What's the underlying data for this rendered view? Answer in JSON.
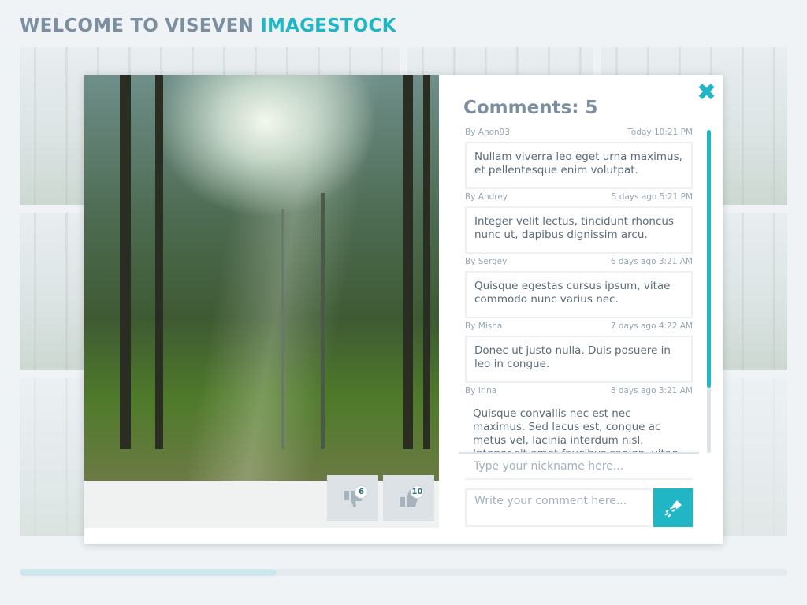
{
  "header": {
    "title_prefix": "WELCOME TO VISEVEN",
    "title_accent": "IMAGESTOCK"
  },
  "colors": {
    "accent": "#20b6c6",
    "title": "#7b8fa1"
  },
  "progress": {
    "value_percent": 33.5
  },
  "modal": {
    "close_icon": "close-icon",
    "votes": {
      "dislikes": "6",
      "likes": "10"
    },
    "comments_title": "Comments: 5",
    "comments": [
      {
        "author": "By Anon93",
        "time": "Today 10:21 PM",
        "text": "Nullam viverra leo eget urna maximus, et pellentesque enim volutpat."
      },
      {
        "author": "By Andrey",
        "time": "5 days ago 5:21 PM",
        "text": "Integer velit lectus, tincidunt rhoncus nunc ut, dapibus dignissim arcu."
      },
      {
        "author": "By Sergey",
        "time": "6 days ago 3:21 AM",
        "text": "Quisque egestas cursus ipsum, vitae commodo nunc varius nec."
      },
      {
        "author": "By Misha",
        "time": "7 days ago 4:22 AM",
        "text": "Donec ut justo nulla. Duis posuere in leo in congue."
      },
      {
        "author": "By Irina",
        "time": "8 days ago 3:21 AM",
        "text": "Quisque convallis nec est nec maximus. Sed lacus est, congue ac metus vel, lacinia interdum nisl. Integer sit amet faucibus sapien, vitae dictum sapien"
      }
    ],
    "nickname_placeholder": "Type your nickname here...",
    "comment_placeholder": "Write your comment here..."
  }
}
